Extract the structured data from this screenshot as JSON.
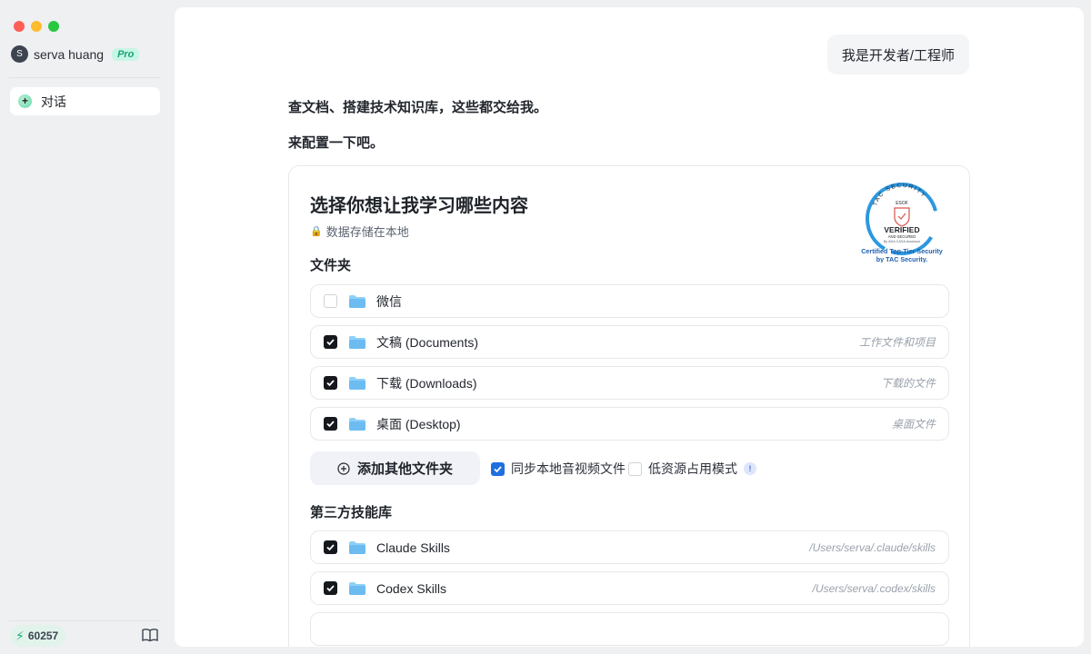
{
  "sidebar": {
    "user": {
      "avatar_letter": "S",
      "name": "serva huang",
      "badge": "Pro"
    },
    "nav": [
      {
        "label": "对话",
        "icon": "plus-icon"
      }
    ],
    "credits": {
      "value": "60257",
      "icon": "bolt-icon"
    },
    "footer_icon": "book-icon"
  },
  "chat": {
    "user_message": "我是开发者/工程师",
    "assistant_lines": [
      "查文档、搭建技术知识库，这些都交给我。",
      "来配置一下吧。"
    ]
  },
  "card": {
    "title": "选择你想让我学习哪些内容",
    "subtitle": "数据存储在本地",
    "seal": {
      "ring_text": "TAC SECURITY",
      "top": "ESOF",
      "verified": "VERIFIED",
      "secured": "AND SECURED",
      "by": "By ADA CASA Assessor",
      "caption1": "Certified Top-Tier Security",
      "caption2": "by TAC Security."
    },
    "folders_title": "文件夹",
    "folders": [
      {
        "label": "微信",
        "hint": "",
        "checked": false
      },
      {
        "label": "文稿 (Documents)",
        "hint": "工作文件和项目",
        "checked": true
      },
      {
        "label": "下载 (Downloads)",
        "hint": "下载的文件",
        "checked": true
      },
      {
        "label": "桌面 (Desktop)",
        "hint": "桌面文件",
        "checked": true
      }
    ],
    "add_folder_label": "添加其他文件夹",
    "options": {
      "sync_av": {
        "label": "同步本地音视频文件",
        "checked": true
      },
      "low_resource": {
        "label": "低资源占用模式",
        "checked": false,
        "info": "!"
      }
    },
    "skills_title": "第三方技能库",
    "skills": [
      {
        "label": "Claude Skills",
        "hint": "/Users/serva/.claude/skills",
        "checked": true
      },
      {
        "label": "Codex Skills",
        "hint": "/Users/serva/.codex/skills",
        "checked": true
      }
    ]
  },
  "colors": {
    "accent_green": "#19b07a",
    "checkbox_dark": "#15181d",
    "checkbox_blue": "#1f6fe0",
    "folder_blue": "#7cc3f5",
    "seal_blue": "#1f5fb0"
  }
}
